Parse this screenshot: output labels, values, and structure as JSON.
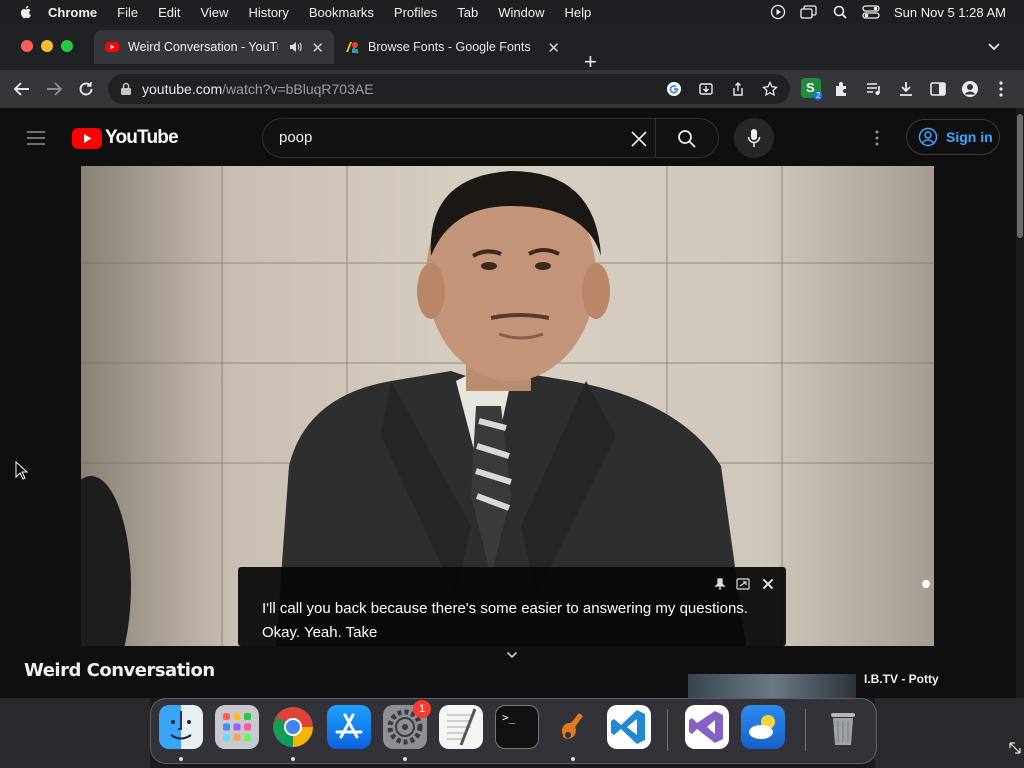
{
  "menubar": {
    "app": "Chrome",
    "items": [
      "File",
      "Edit",
      "View",
      "History",
      "Bookmarks",
      "Profiles",
      "Tab",
      "Window",
      "Help"
    ],
    "clock": "Sun Nov 5  1:28 AM"
  },
  "tabs": [
    {
      "title": "Weird Conversation - YouTube",
      "active": true
    },
    {
      "title": "Browse Fonts - Google Fonts",
      "active": false
    }
  ],
  "toolbar": {
    "url_host": "youtube.com",
    "url_path": "/watch?v=bBluqR703AE",
    "extension_badge": "2"
  },
  "youtube": {
    "logo_text": "YouTube",
    "search_query": "poop",
    "signin_label": "Sign in",
    "video_title": "Weird Conversation",
    "recommended_title": "I.B.TV - Potty"
  },
  "caption": {
    "text": "I'll call you back because there's some easier to answering my questions. Okay. Yeah. Take"
  },
  "dock": {
    "apps": [
      "Finder",
      "Launchpad",
      "Google Chrome",
      "App Store",
      "System Settings",
      "TextEdit",
      "Terminal",
      "GarageBand",
      "Visual Studio Code",
      "Visual Studio",
      "Weather",
      "Trash"
    ],
    "settings_badge": "1"
  },
  "colors": {
    "youtube_red": "#ff0000",
    "signin_blue": "#3ea6ff",
    "page_bg": "#0f0f0f"
  }
}
